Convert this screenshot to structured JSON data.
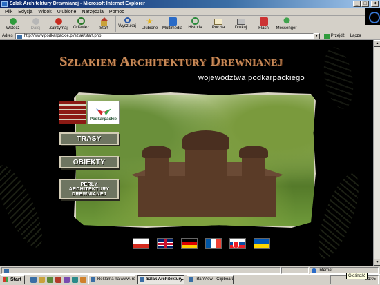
{
  "window": {
    "title": "Szlak Architektury Drewnianej - Microsoft Internet Explorer",
    "buttons": [
      "_",
      "□",
      "×"
    ]
  },
  "menu": [
    "Plik",
    "Edycja",
    "Widok",
    "Ulubione",
    "Narzędzia",
    "Pomoc"
  ],
  "toolbar": [
    {
      "label": "Wstecz",
      "icon": "back-arrow-icon"
    },
    {
      "label": "Dalej",
      "icon": "forward-arrow-icon"
    },
    {
      "label": "Zatrzymaj",
      "icon": "stop-icon"
    },
    {
      "label": "Odśwież",
      "icon": "refresh-icon"
    },
    {
      "label": "Start",
      "icon": "home-icon"
    },
    {
      "label": "Wyszukaj",
      "icon": "search-icon"
    },
    {
      "label": "Ulubione",
      "icon": "favorites-icon"
    },
    {
      "label": "Multimedia",
      "icon": "media-icon"
    },
    {
      "label": "Historia",
      "icon": "history-icon"
    },
    {
      "label": "Poczta",
      "icon": "mail-icon"
    },
    {
      "label": "Drukuj",
      "icon": "print-icon"
    },
    {
      "label": "Flash",
      "icon": "flash-icon"
    },
    {
      "label": "Messenger",
      "icon": "messenger-icon"
    }
  ],
  "address": {
    "label": "Adres",
    "url": "http://www.podkarpackie.pl/szlak/start.php",
    "go_label": "Przejdź",
    "links_label": "Łącza"
  },
  "page": {
    "title": "Szlakiem Architektury Drewnianej",
    "subtitle": "województwa podkarpackiego",
    "region_logo_text": "Podkarpackie",
    "nav": {
      "trasy": "TRASY",
      "obiekty": "OBIEKTY",
      "perly_lines": [
        "PERŁY",
        "ARCHITEKTURY",
        "DREWNIANEJ"
      ]
    },
    "flags": [
      "pl",
      "gb",
      "de",
      "fr",
      "sk",
      "ua"
    ]
  },
  "status": {
    "zone": "Internet"
  },
  "taskbar": {
    "start": "Start",
    "tasks": [
      {
        "label": "Reklama na www. real..."
      },
      {
        "label": "Szlak Architektury...",
        "active": true
      },
      {
        "label": "IrfanView - Clipboard (..."
      }
    ],
    "clock": "21:05",
    "tooltip": "Głośność"
  }
}
